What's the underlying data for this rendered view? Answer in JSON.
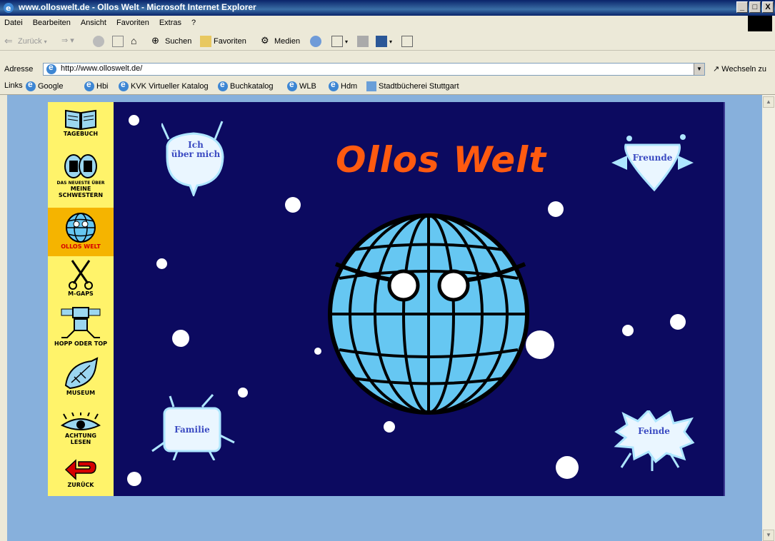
{
  "window": {
    "title": "www.olloswelt.de - Ollos Welt - Microsoft Internet Explorer",
    "buttons": [
      "_",
      "□",
      "X"
    ]
  },
  "menu": [
    "Datei",
    "Bearbeiten",
    "Ansicht",
    "Favoriten",
    "Extras",
    "?"
  ],
  "toolbar": {
    "back": "Zurück",
    "search": "Suchen",
    "favorites": "Favoriten",
    "media": "Medien"
  },
  "address": {
    "label": "Adresse",
    "url": "http://www.olloswelt.de/",
    "go": "Wechseln zu"
  },
  "links": {
    "label": "Links",
    "items": [
      "Google",
      "Hbi",
      "KVK Virtueller Katalog",
      "Buchkatalog",
      "WLB",
      "Hdm",
      "Stadtbücherei Stuttgart"
    ]
  },
  "nav": [
    {
      "label": "TAGEBUCH",
      "icon": "book-icon"
    },
    {
      "label": "DAS NEUESTE ÜBER",
      "label2": "MEINE",
      "label3": "SCHWESTERN",
      "icon": "sisters-icon"
    },
    {
      "label": "OLLOS WELT",
      "icon": "globe-icon",
      "active": true
    },
    {
      "label": "M-GAPS",
      "icon": "scissors-icon"
    },
    {
      "label": "HOPP ODER TOP",
      "icon": "robot-icon"
    },
    {
      "label": "MUSEUM",
      "icon": "fish-icon"
    },
    {
      "label": "ACHTUNG",
      "label2": "LESEN",
      "icon": "eye-icon"
    },
    {
      "label": "ZURÜCK",
      "icon": "back-arrow-icon"
    }
  ],
  "site": {
    "logo": "Ollos Welt",
    "bubbles": {
      "about_1": "Ich",
      "about_2": "über mich",
      "friends": "Freunde",
      "family": "Familie",
      "enemies": "Feinde"
    }
  },
  "colors": {
    "site_bg": "#0c0a60",
    "sidebar": "#fff36a",
    "logo": "#ff5a10",
    "globe": "#66c7f2"
  }
}
